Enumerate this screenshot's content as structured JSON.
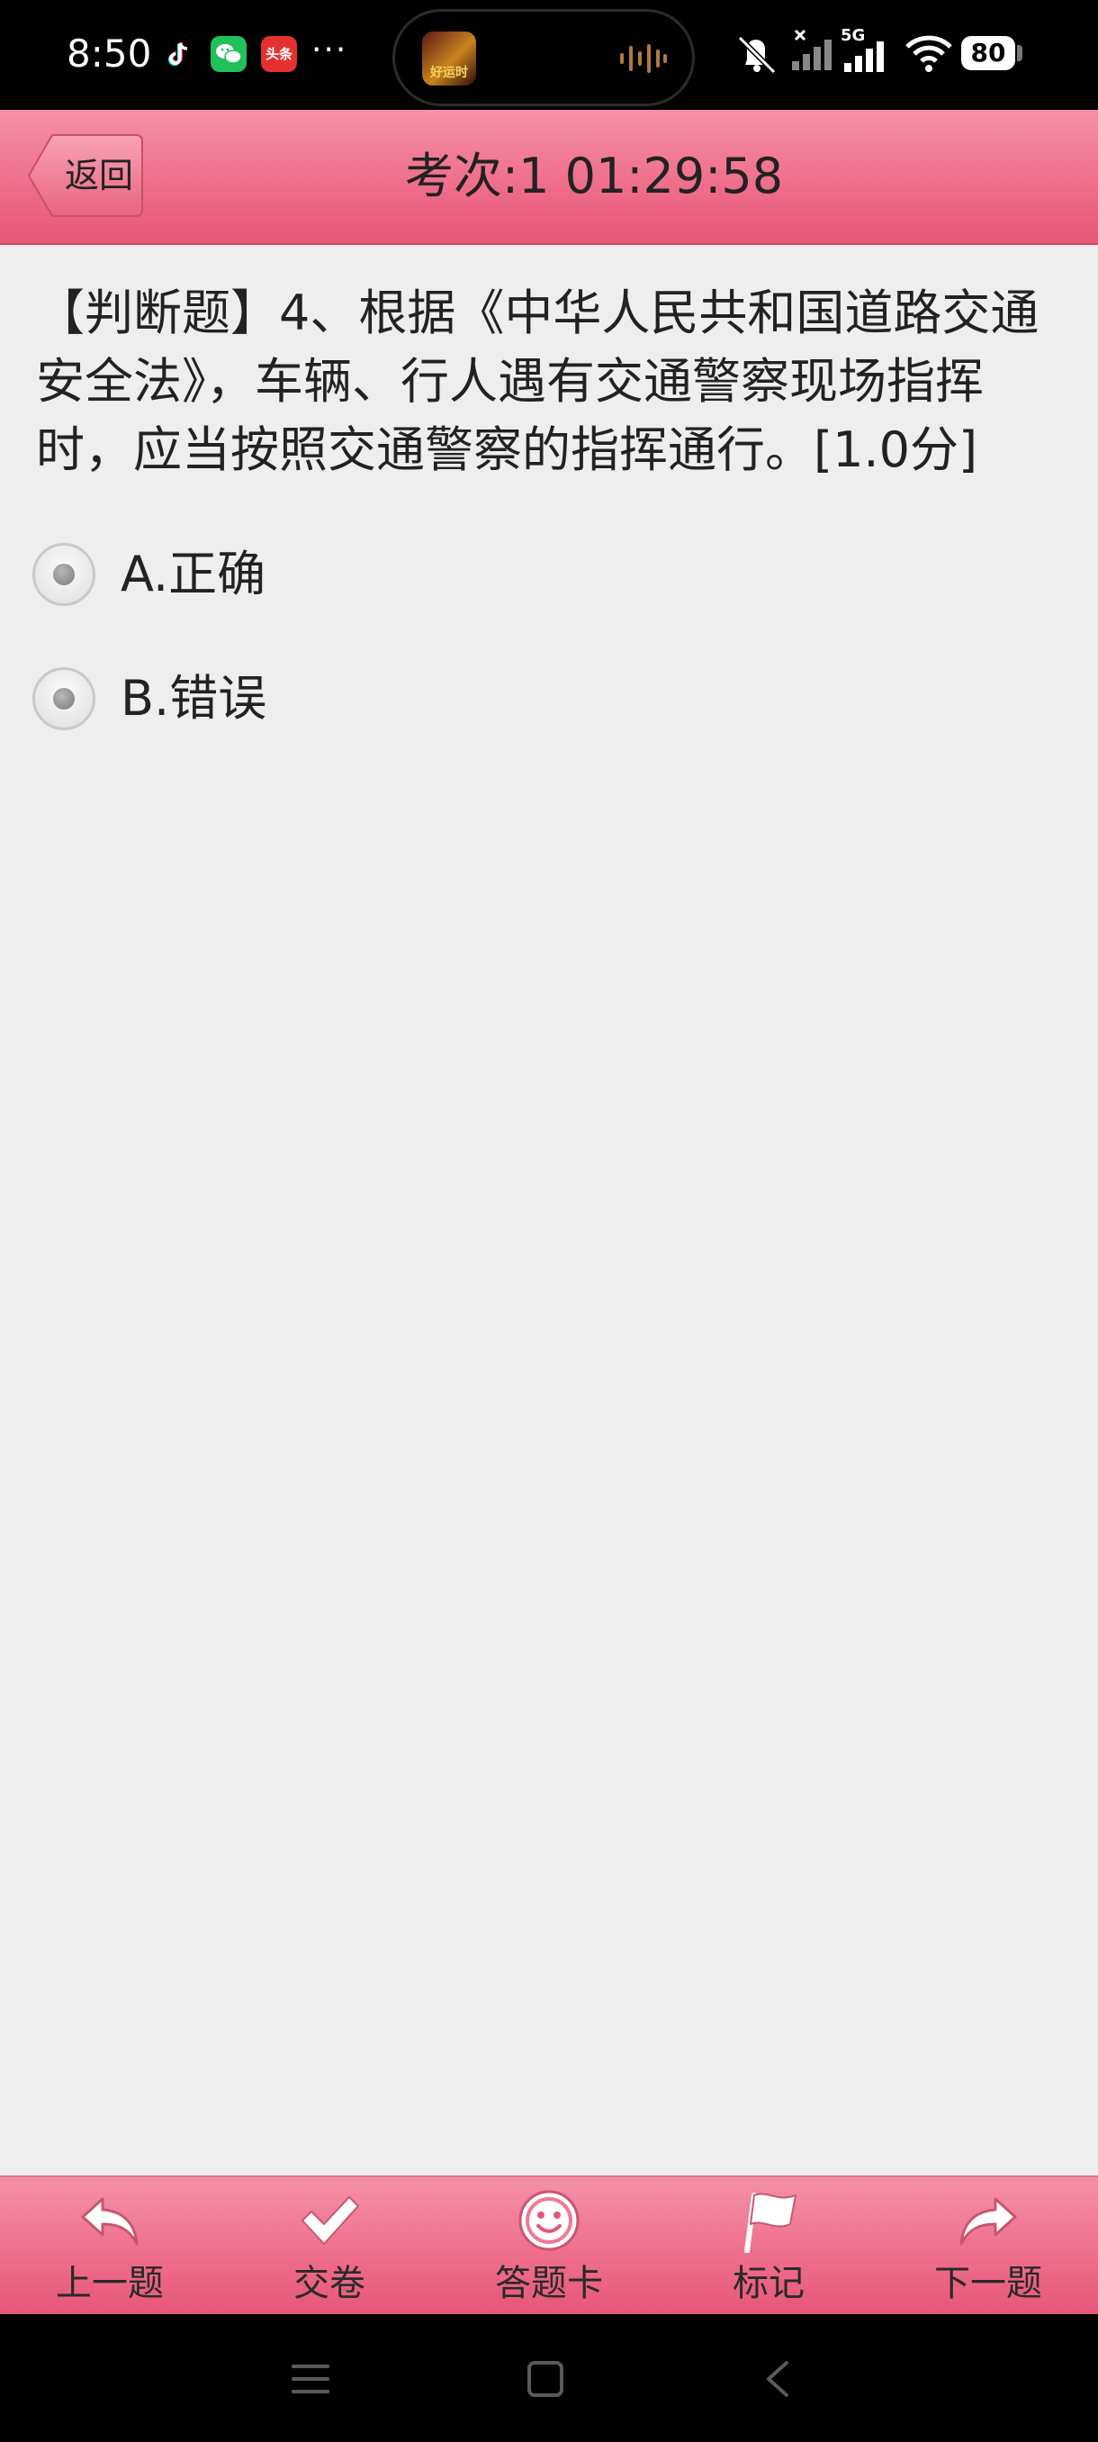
{
  "status_bar": {
    "time": "8:50",
    "notification_apps": [
      "tiktok-icon",
      "wechat-icon",
      "toutiao-icon"
    ],
    "toutiao_label": "头条",
    "more_indicator": "···",
    "media_art_text": "好运时",
    "network": "5G",
    "battery": "80"
  },
  "header": {
    "back_label": "返回",
    "title": "考次:1  01:29:58",
    "accent_color": "#ef6f8c"
  },
  "question": {
    "text": "【判断题】4、根据《中华人民共和国道路交通安全法》，车辆、行人遇有交通警察现场指挥时，应当按照交通警察的指挥通行。[1.0分]"
  },
  "options": [
    {
      "label": "A.正确",
      "selected": false
    },
    {
      "label": "B.错误",
      "selected": false
    }
  ],
  "toolbar": {
    "items": [
      {
        "label": "上一题",
        "icon": "undo-arrow-icon"
      },
      {
        "label": "交卷",
        "icon": "checkmark-icon"
      },
      {
        "label": "答题卡",
        "icon": "smiley-icon"
      },
      {
        "label": "标记",
        "icon": "flag-icon"
      },
      {
        "label": "下一题",
        "icon": "redo-arrow-icon"
      }
    ]
  },
  "nav_bar": {
    "buttons": [
      "menu-icon",
      "home-icon",
      "back-icon"
    ]
  }
}
